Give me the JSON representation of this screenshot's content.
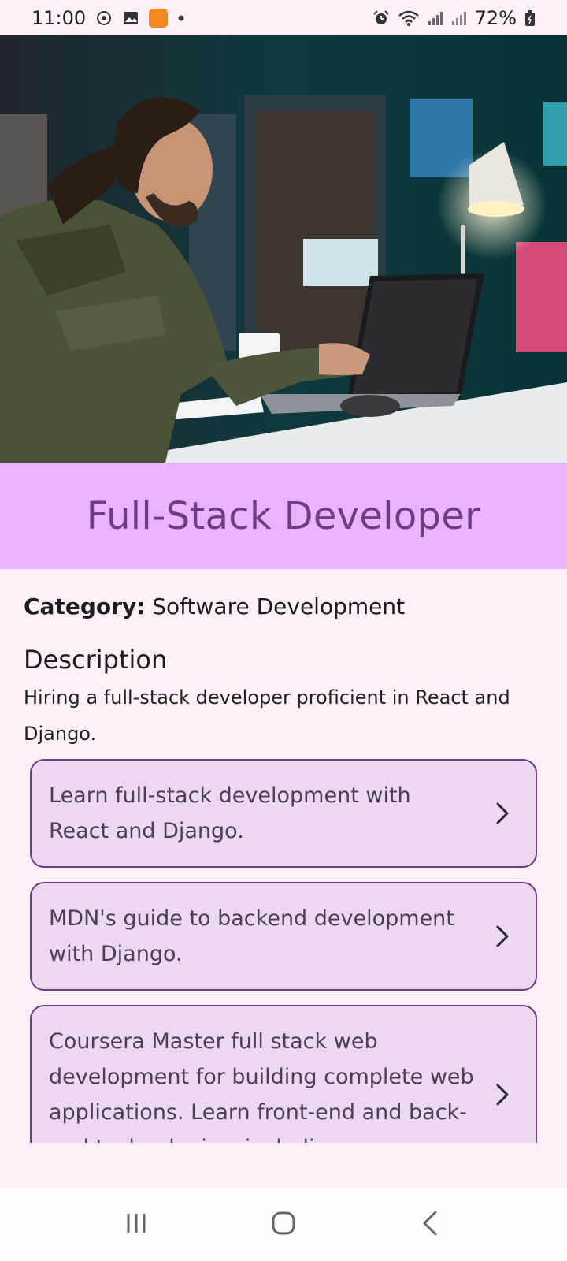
{
  "status_bar": {
    "time": "11:00",
    "battery": "72%",
    "icons": [
      "weather-icon",
      "gallery-icon",
      "app-notification-icon",
      "dot-icon",
      "alarm-icon",
      "wifi-icon",
      "signal-icon",
      "signal-icon-2",
      "battery-icon"
    ]
  },
  "hero": {
    "image": "developer-at-laptop-photo"
  },
  "job": {
    "title": "Full-Stack Developer",
    "category_label": "Category:",
    "category_value": "Software Development",
    "description_heading": "Description",
    "description": "Hiring a full-stack developer proficient in React and Django."
  },
  "resources": [
    {
      "text": "Learn full-stack development with React and Django."
    },
    {
      "text": "MDN's guide to backend development with Django."
    },
    {
      "text": "Coursera Master full stack web development for building complete web applications. Learn front-end and back-end technologies, including"
    }
  ],
  "nav": {
    "icons": [
      "recents-icon",
      "home-icon",
      "back-icon"
    ]
  },
  "colors": {
    "title_band": "#ebb3fb",
    "title_text": "#6f3c86",
    "card_bg": "#ecd8ef",
    "card_border": "#6e3b86",
    "page_bg": "#fdf0f8"
  }
}
